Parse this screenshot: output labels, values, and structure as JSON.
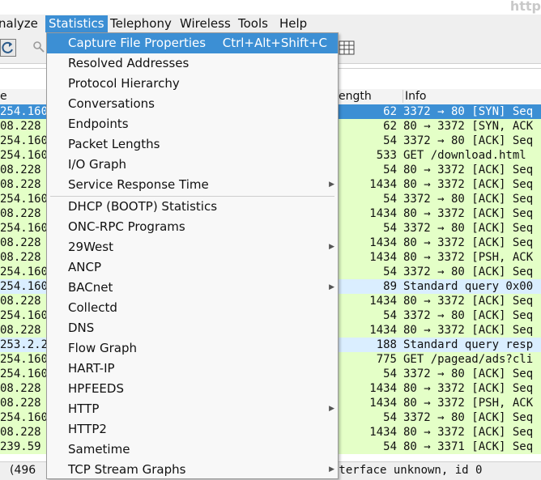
{
  "window": {
    "title": "http"
  },
  "menubar": [
    {
      "label": "nalyze"
    },
    {
      "label": "Statistics"
    },
    {
      "label": "Telephony"
    },
    {
      "label": "Wireless"
    },
    {
      "label": "Tools"
    },
    {
      "label": "Help"
    }
  ],
  "packet_list": {
    "columns": [
      "e",
      "ength",
      "Info"
    ],
    "rows": [
      {
        "src": "254.160",
        "len": "62",
        "info": "3372 → 80 [SYN] Seq",
        "style": "selected"
      },
      {
        "src": "08.228",
        "len": "62",
        "info": "80 → 3372 [SYN, ACK",
        "style": "green"
      },
      {
        "src": "254.160",
        "len": "54",
        "info": "3372 → 80 [ACK] Seq",
        "style": "green"
      },
      {
        "src": "254.160",
        "len": "533",
        "info": "GET /download.html ",
        "style": "green"
      },
      {
        "src": "08.228",
        "len": "54",
        "info": "80 → 3372 [ACK] Seq",
        "style": "green"
      },
      {
        "src": "08.228",
        "len": "1434",
        "info": "80 → 3372 [ACK] Seq",
        "style": "green"
      },
      {
        "src": "254.160",
        "len": "54",
        "info": "3372 → 80 [ACK] Seq",
        "style": "green"
      },
      {
        "src": "08.228",
        "len": "1434",
        "info": "80 → 3372 [ACK] Seq",
        "style": "green"
      },
      {
        "src": "254.160",
        "len": "54",
        "info": "3372 → 80 [ACK] Seq",
        "style": "green"
      },
      {
        "src": "08.228",
        "len": "1434",
        "info": "80 → 3372 [ACK] Seq",
        "style": "green"
      },
      {
        "src": "08.228",
        "len": "1434",
        "info": "80 → 3372 [PSH, ACK",
        "style": "green"
      },
      {
        "src": "254.160",
        "len": "54",
        "info": "3372 → 80 [ACK] Seq",
        "style": "green"
      },
      {
        "src": "254.160",
        "len": "89",
        "info": "Standard query 0x00",
        "style": "blue"
      },
      {
        "src": "08.228",
        "len": "1434",
        "info": "80 → 3372 [ACK] Seq",
        "style": "green"
      },
      {
        "src": "254.160",
        "len": "54",
        "info": "3372 → 80 [ACK] Seq",
        "style": "green"
      },
      {
        "src": "08.228",
        "len": "1434",
        "info": "80 → 3372 [ACK] Seq",
        "style": "green"
      },
      {
        "src": "253.2.2",
        "len": "188",
        "info": "Standard query resp",
        "style": "blue"
      },
      {
        "src": "254.160",
        "len": "775",
        "info": "GET /pagead/ads?cli",
        "style": "green"
      },
      {
        "src": "254.160",
        "len": "54",
        "info": "3372 → 80 [ACK] Seq",
        "style": "green"
      },
      {
        "src": "08.228",
        "len": "1434",
        "info": "80 → 3372 [ACK] Seq",
        "style": "green"
      },
      {
        "src": "08.228",
        "len": "1434",
        "info": "80 → 3372 [PSH, ACK",
        "style": "green"
      },
      {
        "src": "254.160",
        "len": "54",
        "info": "3372 → 80 [ACK] Seq",
        "style": "green"
      },
      {
        "src": "08.228",
        "len": "1434",
        "info": "80 → 3372 [ACK] Seq",
        "style": "green"
      },
      {
        "src": "239.59",
        "len": "54",
        "info": "80 → 3371 [ACK] Seq",
        "style": "green"
      }
    ]
  },
  "statusbar": {
    "left": "(496",
    "right": "nterface unknown, id 0"
  },
  "statistics_menu": {
    "items": [
      {
        "label": "Capture File Properties",
        "shortcut": "Ctrl+Alt+Shift+C",
        "highlighted": true
      },
      {
        "label": "Resolved Addresses"
      },
      {
        "label": "Protocol Hierarchy"
      },
      {
        "label": "Conversations"
      },
      {
        "label": "Endpoints"
      },
      {
        "label": "Packet Lengths"
      },
      {
        "label": "I/O Graph"
      },
      {
        "label": "Service Response Time",
        "submenu": true
      },
      {
        "separator": true
      },
      {
        "label": "DHCP (BOOTP) Statistics"
      },
      {
        "label": "ONC-RPC Programs"
      },
      {
        "label": "29West",
        "submenu": true
      },
      {
        "label": "ANCP"
      },
      {
        "label": "BACnet",
        "submenu": true
      },
      {
        "label": "Collectd"
      },
      {
        "label": "DNS"
      },
      {
        "label": "Flow Graph"
      },
      {
        "label": "HART-IP"
      },
      {
        "label": "HPFEEDS"
      },
      {
        "label": "HTTP",
        "submenu": true
      },
      {
        "label": "HTTP2"
      },
      {
        "label": "Sametime"
      },
      {
        "label": "TCP Stream Graphs",
        "submenu": true
      }
    ]
  },
  "colors": {
    "highlight": "#3c8fd4",
    "row_green": "#e4ffc7",
    "row_blue": "#daeeff"
  },
  "icons": {
    "reload": "reload-icon",
    "find": "search-icon",
    "columns": "resize-columns-icon",
    "submenu": "submenu-arrow-icon"
  }
}
